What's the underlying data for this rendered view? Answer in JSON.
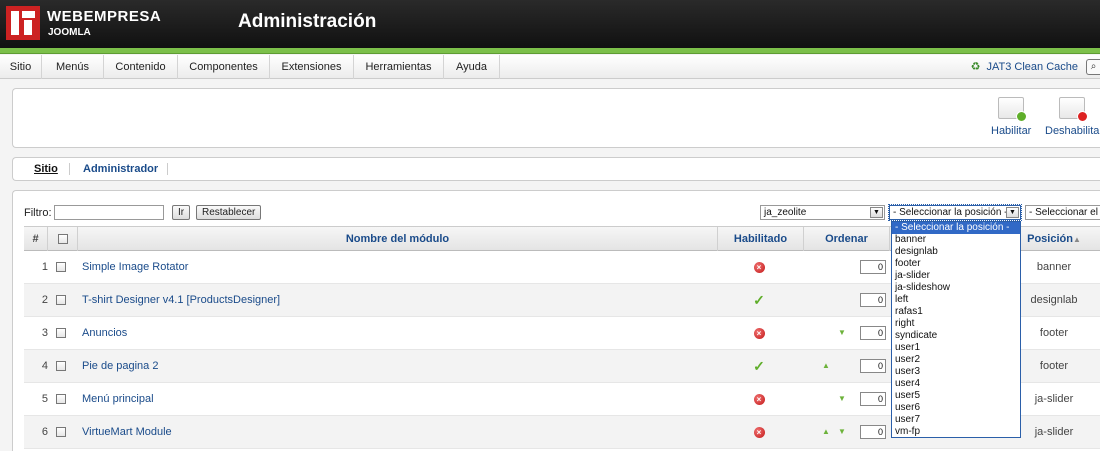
{
  "header": {
    "brand": "WEBEMPRESA",
    "brand_sub": "JOOMLA",
    "title": "Administración"
  },
  "menu": [
    "Sitio",
    "Menús",
    "Contenido",
    "Componentes",
    "Extensiones",
    "Herramientas",
    "Ayuda"
  ],
  "cache_label": "JAT3 Clean Cache",
  "toolbar": {
    "enable_label": "Habilitar",
    "disable_label": "Deshabilita"
  },
  "subtabs": [
    "Sitio",
    "Administrador"
  ],
  "filter": {
    "label": "Filtro:",
    "value": "",
    "go_button": "Ir",
    "reset_button": "Restablecer"
  },
  "selects": {
    "template": "ja_zeolite",
    "position": "- Seleccionar la posición -",
    "type": "- Seleccionar el ti"
  },
  "table": {
    "headers": {
      "num": "#",
      "name": "Nombre del módulo",
      "enabled": "Habilitado",
      "order": "Ordenar",
      "position": "Posición"
    },
    "rows": [
      {
        "num": "1",
        "name": "Simple Image Rotator",
        "enabled": false,
        "order": "0",
        "up": false,
        "down": false,
        "position": "banner"
      },
      {
        "num": "2",
        "name": "T-shirt Designer v4.1 [ProductsDesigner]",
        "enabled": true,
        "order": "0",
        "up": false,
        "down": false,
        "position": "designlab"
      },
      {
        "num": "3",
        "name": "Anuncios",
        "enabled": false,
        "order": "0",
        "up": false,
        "down": true,
        "position": "footer"
      },
      {
        "num": "4",
        "name": "Pie de pagina 2",
        "enabled": true,
        "order": "0",
        "up": true,
        "down": false,
        "position": "footer"
      },
      {
        "num": "5",
        "name": "Menú principal",
        "enabled": false,
        "order": "0",
        "up": false,
        "down": true,
        "position": "ja-slider"
      },
      {
        "num": "6",
        "name": "VirtueMart Module",
        "enabled": false,
        "order": "0",
        "up": true,
        "down": true,
        "position": "ja-slider"
      }
    ]
  },
  "position_options": [
    "- Seleccionar la posición -",
    "banner",
    "designlab",
    "footer",
    "ja-slider",
    "ja-slideshow",
    "left",
    "rafas1",
    "right",
    "syndicate",
    "user1",
    "user2",
    "user3",
    "user4",
    "user5",
    "user6",
    "user7",
    "vm-fp"
  ],
  "colors": {
    "accent_green": "#7cc04a",
    "link_blue": "#1a4b8a",
    "selected_blue": "#3169c6"
  }
}
